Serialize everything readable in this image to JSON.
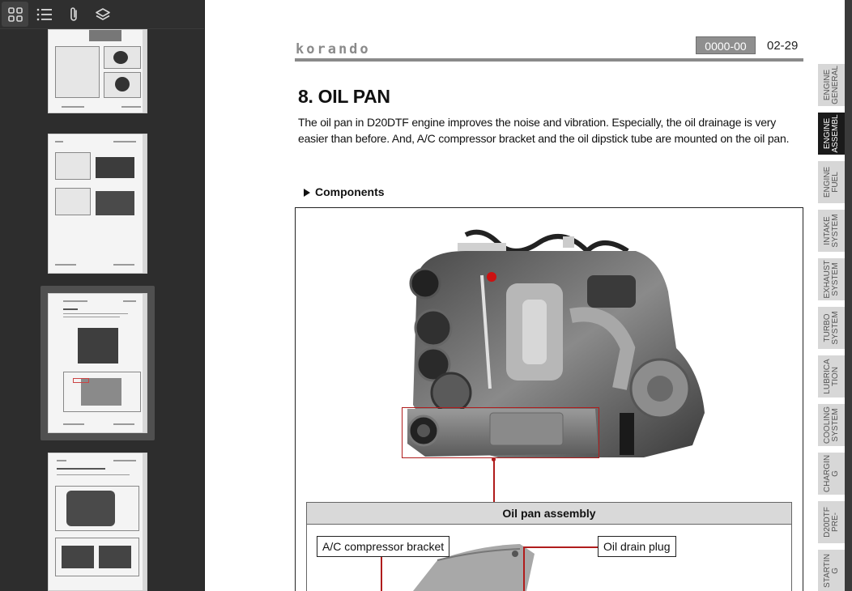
{
  "sidebar": {
    "toolbar": {
      "thumbnails_icon": "grid-icon",
      "outline_icon": "list-icon",
      "attachments_icon": "paperclip-icon",
      "layers_icon": "layers-icon"
    }
  },
  "document": {
    "brand": "korando",
    "section_code": "0000-00",
    "page_number": "02-29",
    "title": "8. OIL PAN",
    "intro": "The oil pan in D20DTF engine improves the noise and vibration. Especially, the oil drainage is very easier than before. And, A/C compressor bracket and the oil dipstick tube are mounted on the oil pan.",
    "components_heading": "Components",
    "assembly_label": "Oil pan assembly",
    "callouts": {
      "ac_bracket": "A/C compressor bracket",
      "drain_plug": "Oil drain plug"
    }
  },
  "tabs": [
    {
      "label": "ENGINE\nGENERAL",
      "active": false
    },
    {
      "label": "ENGINE\nASSEMBL",
      "active": true
    },
    {
      "label": "ENGINE\nFUEL",
      "active": false
    },
    {
      "label": "INTAKE\nSYSTEM",
      "active": false
    },
    {
      "label": "EXHAUST\nSYSTEM",
      "active": false
    },
    {
      "label": "TURBO\nSYSTEM",
      "active": false
    },
    {
      "label": "LUBRICA\nTION",
      "active": false
    },
    {
      "label": "COOLING\nSYSTEM",
      "active": false
    },
    {
      "label": "CHARGIN\nG",
      "active": false
    },
    {
      "label": "D20DTF\nPRE-",
      "active": false
    },
    {
      "label": "STARTIN\nG",
      "active": false
    }
  ],
  "colors": {
    "accent_red": "#b01c1c",
    "active_tab": "#1a1a1a",
    "inactive_tab": "#d7d7d7"
  }
}
